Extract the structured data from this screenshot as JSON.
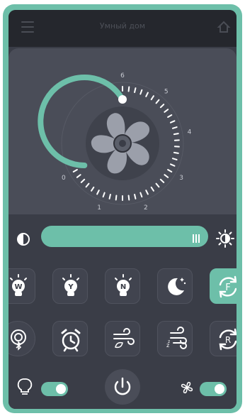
{
  "header": {
    "title": "Умный дом",
    "menu_icon": "hamburger-menu-icon",
    "home_icon": "home-icon"
  },
  "fan": {
    "speed_labels": [
      "0",
      "1",
      "2",
      "3",
      "4",
      "5",
      "6"
    ],
    "current_speed": 6,
    "max_speed": 6,
    "accent_color": "#6dbfa9"
  },
  "brightness": {
    "level": 1.0,
    "min_icon": "contrast-icon",
    "max_icon": "sun-icon"
  },
  "modes_row1": [
    {
      "icon": "bulb-w-icon",
      "label": "W",
      "active": false
    },
    {
      "icon": "bulb-y-icon",
      "label": "Y",
      "active": false
    },
    {
      "icon": "bulb-n-icon",
      "label": "N",
      "active": false
    },
    {
      "icon": "moon-stars-icon",
      "label": "",
      "active": false
    },
    {
      "icon": "cycle-f-icon",
      "label": "F",
      "active": true
    }
  ],
  "modes_row2": [
    {
      "icon": "bluetooth-icon",
      "label": "",
      "active": false
    },
    {
      "icon": "alarm-clock-icon",
      "label": "",
      "active": false
    },
    {
      "icon": "wind-leaf-icon",
      "label": "",
      "active": false
    },
    {
      "icon": "wind-sleep-icon",
      "label": "",
      "active": false
    },
    {
      "icon": "reverse-r-icon",
      "label": "R",
      "active": false
    }
  ],
  "bottom": {
    "light_toggle_on": true,
    "fan_toggle_on": true
  },
  "colors": {
    "frame": "#6dbfa9",
    "screen": "#3a3d47",
    "panel": "#4a4d58"
  }
}
